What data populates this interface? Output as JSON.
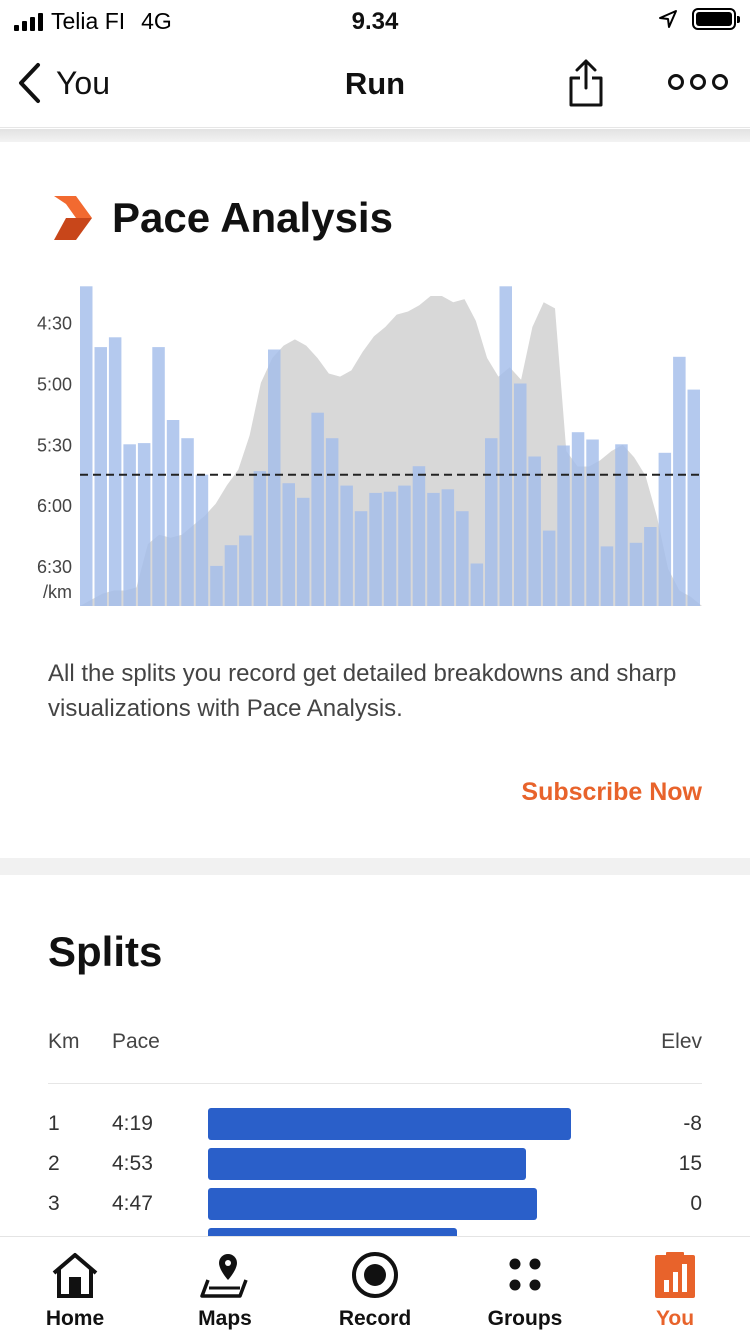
{
  "status_bar": {
    "carrier": "Telia FI",
    "network": "4G",
    "time": "9.34"
  },
  "nav": {
    "back_label": "You",
    "title": "Run"
  },
  "pace_analysis": {
    "title": "Pace Analysis",
    "description": "All the splits you record get detailed breakdowns and sharp visualizations with Pace Analysis.",
    "cta": "Subscribe Now",
    "colors": {
      "brand": "#e8632b",
      "bar": "#a3bdea",
      "elevation": "#d8d8d8"
    }
  },
  "chart_data": {
    "type": "bar",
    "ylabel": "/km",
    "y_ticks": [
      "4:30",
      "5:00",
      "5:30",
      "6:00",
      "6:30"
    ],
    "ylim_pace_min": [
      4.28,
      6.83
    ],
    "average_pace": 5.75,
    "pace_values_min": [
      4.2,
      4.7,
      4.62,
      5.5,
      5.49,
      4.7,
      5.3,
      5.45,
      5.75,
      6.5,
      6.33,
      6.25,
      5.72,
      4.72,
      5.82,
      5.94,
      5.24,
      5.45,
      5.84,
      6.05,
      5.9,
      5.89,
      5.84,
      5.68,
      5.9,
      5.87,
      6.05,
      6.48,
      5.45,
      4.2,
      5.0,
      5.6,
      6.21,
      5.51,
      5.4,
      5.46,
      6.34,
      5.5,
      6.31,
      6.18,
      5.57,
      4.78,
      5.05
    ],
    "elevation_relative": [
      0.0,
      0.02,
      0.04,
      0.05,
      0.05,
      0.06,
      0.2,
      0.23,
      0.22,
      0.23,
      0.26,
      0.29,
      0.33,
      0.39,
      0.44,
      0.55,
      0.72,
      0.8,
      0.84,
      0.86,
      0.84,
      0.8,
      0.75,
      0.74,
      0.76,
      0.82,
      0.87,
      0.9,
      0.94,
      0.95,
      0.97,
      1.0,
      1.0,
      0.98,
      0.99,
      0.92,
      0.8,
      0.74,
      0.77,
      0.73,
      0.9,
      0.98,
      0.96,
      0.5,
      0.45,
      0.45,
      0.47,
      0.5,
      0.52,
      0.48,
      0.42,
      0.29,
      0.12,
      0.05,
      0.03,
      0.0
    ]
  },
  "splits": {
    "title": "Splits",
    "headers": {
      "km": "Km",
      "pace": "Pace",
      "elev": "Elev"
    },
    "rows": [
      {
        "km": "1",
        "pace": "4:19",
        "elev": "-8",
        "relative": 0.84
      },
      {
        "km": "2",
        "pace": "4:53",
        "elev": "15",
        "relative": 0.72
      },
      {
        "km": "3",
        "pace": "4:47",
        "elev": "0",
        "relative": 0.75
      },
      {
        "km": "",
        "pace": "",
        "elev": "",
        "relative": 0.54
      }
    ]
  },
  "tab_bar": {
    "items": [
      {
        "label": "Home",
        "icon": "home-icon"
      },
      {
        "label": "Maps",
        "icon": "maps-icon"
      },
      {
        "label": "Record",
        "icon": "record-icon"
      },
      {
        "label": "Groups",
        "icon": "groups-icon"
      },
      {
        "label": "You",
        "icon": "you-icon",
        "active": true
      }
    ]
  }
}
